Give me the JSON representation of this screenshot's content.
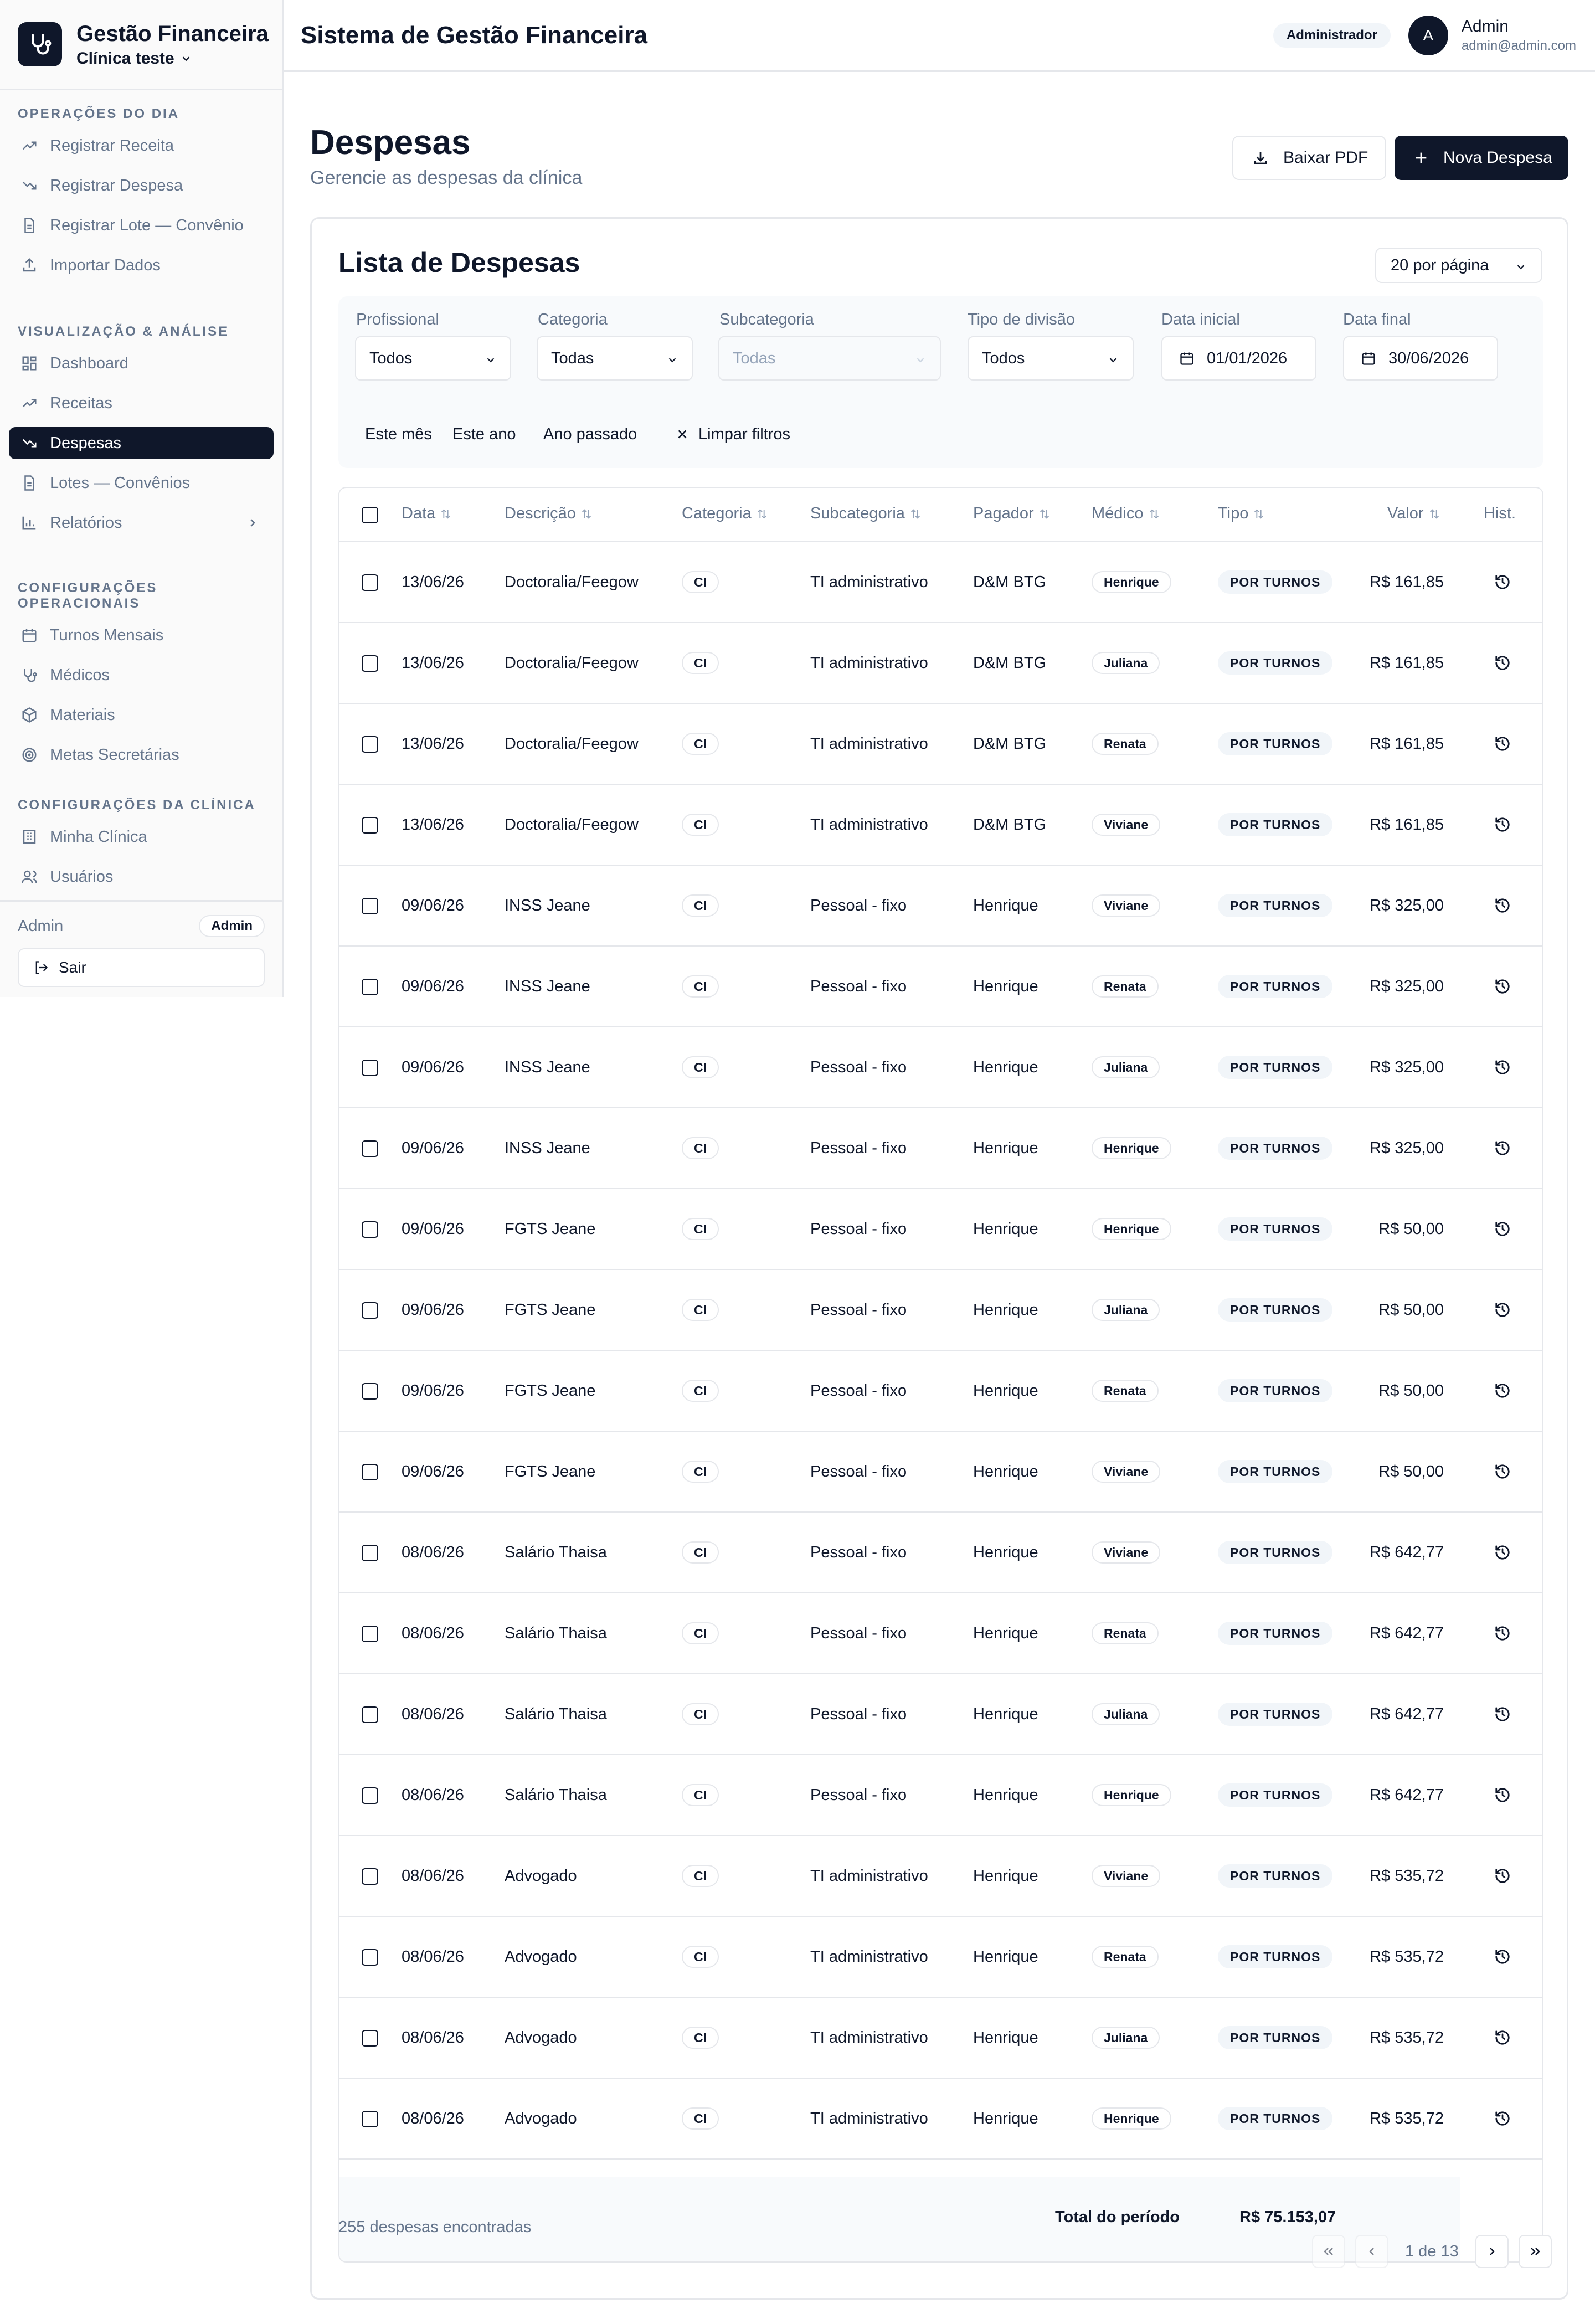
{
  "sidebar": {
    "app_name": "Gestão Financeira",
    "clinic_name": "Clínica teste",
    "sections": [
      {
        "title": "OPERAÇÕES DO DIA",
        "items": [
          {
            "label": "Registrar Receita",
            "icon": "trending-up-icon"
          },
          {
            "label": "Registrar Despesa",
            "icon": "trending-down-icon"
          },
          {
            "label": "Registrar Lote — Convênio",
            "icon": "file-text-icon"
          },
          {
            "label": "Importar Dados",
            "icon": "upload-icon"
          }
        ]
      },
      {
        "title": "VISUALIZAÇÃO & ANÁLISE",
        "items": [
          {
            "label": "Dashboard",
            "icon": "dashboard-icon"
          },
          {
            "label": "Receitas",
            "icon": "trending-up-icon"
          },
          {
            "label": "Despesas",
            "icon": "trending-down-icon",
            "active": true
          },
          {
            "label": "Lotes — Convênios",
            "icon": "file-text-icon"
          },
          {
            "label": "Relatórios",
            "icon": "bar-chart-icon"
          }
        ]
      },
      {
        "title": "CONFIGURAÇÕES OPERACIONAIS",
        "items": [
          {
            "label": "Turnos Mensais",
            "icon": "calendar-icon"
          },
          {
            "label": "Médicos",
            "icon": "stethoscope-icon"
          },
          {
            "label": "Materiais",
            "icon": "package-icon"
          },
          {
            "label": "Metas Secretárias",
            "icon": "target-icon"
          }
        ]
      },
      {
        "title": "CONFIGURAÇÕES DA CLÍNICA",
        "items": [
          {
            "label": "Minha Clínica",
            "icon": "building-icon"
          },
          {
            "label": "Usuários",
            "icon": "users-icon"
          }
        ]
      }
    ],
    "footer": {
      "user": "Admin",
      "badge": "Admin",
      "logout": "Sair"
    }
  },
  "header": {
    "title": "Sistema de Gestão Financeira",
    "role": "Administrador",
    "avatar_letter": "A",
    "user_name": "Admin",
    "user_email": "admin@admin.com"
  },
  "page": {
    "title": "Despesas",
    "subtitle": "Gerencie as despesas da clínica",
    "pdf_button": "Baixar PDF",
    "new_button": "Nova Despesa"
  },
  "list": {
    "title": "Lista de Despesas",
    "per_page": "20 por página",
    "filters": {
      "profissional": {
        "label": "Profissional",
        "value": "Todos"
      },
      "categoria": {
        "label": "Categoria",
        "value": "Todas"
      },
      "subcategoria": {
        "label": "Subcategoria",
        "value": "Todas"
      },
      "tipo_divisao": {
        "label": "Tipo de divisão",
        "value": "Todos"
      },
      "data_inicial": {
        "label": "Data inicial",
        "value": "01/01/2026"
      },
      "data_final": {
        "label": "Data final",
        "value": "30/06/2026"
      }
    },
    "quick_filters": [
      "Este mês",
      "Este ano",
      "Ano passado"
    ],
    "clear_filters": "Limpar filtros",
    "columns": [
      "Data",
      "Descrição",
      "Categoria",
      "Subcategoria",
      "Pagador",
      "Médico",
      "Tipo",
      "Valor",
      "Hist."
    ],
    "rows": [
      {
        "data": "13/06/26",
        "descricao": "Doctoralia/Feegow",
        "categoria": "CI",
        "subcategoria": "TI administrativo",
        "pagador": "D&M BTG",
        "medico": "Henrique",
        "tipo": "POR TURNOS",
        "valor": "R$ 161,85"
      },
      {
        "data": "13/06/26",
        "descricao": "Doctoralia/Feegow",
        "categoria": "CI",
        "subcategoria": "TI administrativo",
        "pagador": "D&M BTG",
        "medico": "Juliana",
        "tipo": "POR TURNOS",
        "valor": "R$ 161,85"
      },
      {
        "data": "13/06/26",
        "descricao": "Doctoralia/Feegow",
        "categoria": "CI",
        "subcategoria": "TI administrativo",
        "pagador": "D&M BTG",
        "medico": "Renata",
        "tipo": "POR TURNOS",
        "valor": "R$ 161,85"
      },
      {
        "data": "13/06/26",
        "descricao": "Doctoralia/Feegow",
        "categoria": "CI",
        "subcategoria": "TI administrativo",
        "pagador": "D&M BTG",
        "medico": "Viviane",
        "tipo": "POR TURNOS",
        "valor": "R$ 161,85"
      },
      {
        "data": "09/06/26",
        "descricao": "INSS Jeane",
        "categoria": "CI",
        "subcategoria": "Pessoal - fixo",
        "pagador": "Henrique",
        "medico": "Viviane",
        "tipo": "POR TURNOS",
        "valor": "R$ 325,00"
      },
      {
        "data": "09/06/26",
        "descricao": "INSS Jeane",
        "categoria": "CI",
        "subcategoria": "Pessoal - fixo",
        "pagador": "Henrique",
        "medico": "Renata",
        "tipo": "POR TURNOS",
        "valor": "R$ 325,00"
      },
      {
        "data": "09/06/26",
        "descricao": "INSS Jeane",
        "categoria": "CI",
        "subcategoria": "Pessoal - fixo",
        "pagador": "Henrique",
        "medico": "Juliana",
        "tipo": "POR TURNOS",
        "valor": "R$ 325,00"
      },
      {
        "data": "09/06/26",
        "descricao": "INSS Jeane",
        "categoria": "CI",
        "subcategoria": "Pessoal - fixo",
        "pagador": "Henrique",
        "medico": "Henrique",
        "tipo": "POR TURNOS",
        "valor": "R$ 325,00"
      },
      {
        "data": "09/06/26",
        "descricao": "FGTS Jeane",
        "categoria": "CI",
        "subcategoria": "Pessoal - fixo",
        "pagador": "Henrique",
        "medico": "Henrique",
        "tipo": "POR TURNOS",
        "valor": "R$ 50,00"
      },
      {
        "data": "09/06/26",
        "descricao": "FGTS Jeane",
        "categoria": "CI",
        "subcategoria": "Pessoal - fixo",
        "pagador": "Henrique",
        "medico": "Juliana",
        "tipo": "POR TURNOS",
        "valor": "R$ 50,00"
      },
      {
        "data": "09/06/26",
        "descricao": "FGTS Jeane",
        "categoria": "CI",
        "subcategoria": "Pessoal - fixo",
        "pagador": "Henrique",
        "medico": "Renata",
        "tipo": "POR TURNOS",
        "valor": "R$ 50,00"
      },
      {
        "data": "09/06/26",
        "descricao": "FGTS Jeane",
        "categoria": "CI",
        "subcategoria": "Pessoal - fixo",
        "pagador": "Henrique",
        "medico": "Viviane",
        "tipo": "POR TURNOS",
        "valor": "R$ 50,00"
      },
      {
        "data": "08/06/26",
        "descricao": "Salário Thaisa",
        "categoria": "CI",
        "subcategoria": "Pessoal - fixo",
        "pagador": "Henrique",
        "medico": "Viviane",
        "tipo": "POR TURNOS",
        "valor": "R$ 642,77"
      },
      {
        "data": "08/06/26",
        "descricao": "Salário Thaisa",
        "categoria": "CI",
        "subcategoria": "Pessoal - fixo",
        "pagador": "Henrique",
        "medico": "Renata",
        "tipo": "POR TURNOS",
        "valor": "R$ 642,77"
      },
      {
        "data": "08/06/26",
        "descricao": "Salário Thaisa",
        "categoria": "CI",
        "subcategoria": "Pessoal - fixo",
        "pagador": "Henrique",
        "medico": "Juliana",
        "tipo": "POR TURNOS",
        "valor": "R$ 642,77"
      },
      {
        "data": "08/06/26",
        "descricao": "Salário Thaisa",
        "categoria": "CI",
        "subcategoria": "Pessoal - fixo",
        "pagador": "Henrique",
        "medico": "Henrique",
        "tipo": "POR TURNOS",
        "valor": "R$ 642,77"
      },
      {
        "data": "08/06/26",
        "descricao": "Advogado",
        "categoria": "CI",
        "subcategoria": "TI administrativo",
        "pagador": "Henrique",
        "medico": "Viviane",
        "tipo": "POR TURNOS",
        "valor": "R$ 535,72"
      },
      {
        "data": "08/06/26",
        "descricao": "Advogado",
        "categoria": "CI",
        "subcategoria": "TI administrativo",
        "pagador": "Henrique",
        "medico": "Renata",
        "tipo": "POR TURNOS",
        "valor": "R$ 535,72"
      },
      {
        "data": "08/06/26",
        "descricao": "Advogado",
        "categoria": "CI",
        "subcategoria": "TI administrativo",
        "pagador": "Henrique",
        "medico": "Juliana",
        "tipo": "POR TURNOS",
        "valor": "R$ 535,72"
      },
      {
        "data": "08/06/26",
        "descricao": "Advogado",
        "categoria": "CI",
        "subcategoria": "TI administrativo",
        "pagador": "Henrique",
        "medico": "Henrique",
        "tipo": "POR TURNOS",
        "valor": "R$ 535,72"
      }
    ],
    "total_label": "Total do período",
    "total_value": "R$ 75.153,07",
    "count_text": "255 despesas encontradas",
    "pagination": "1 de 13"
  }
}
